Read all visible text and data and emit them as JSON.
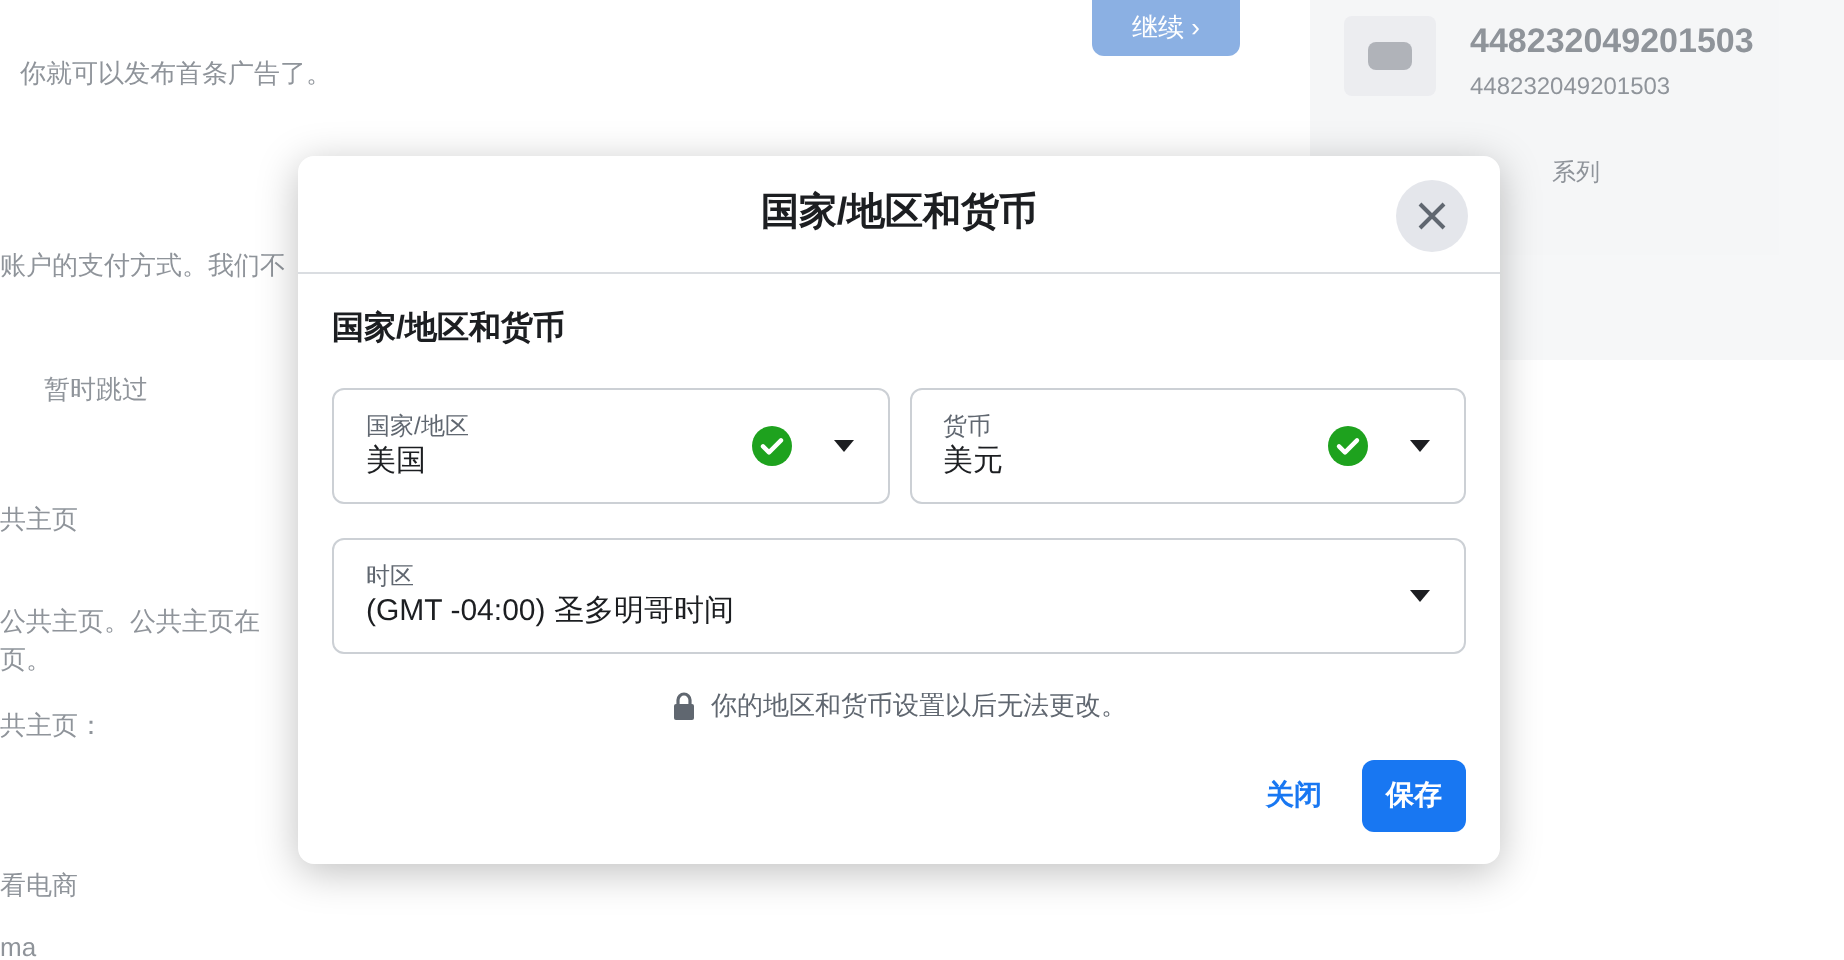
{
  "background": {
    "top_button": "继续",
    "top_button_chevron": "›",
    "intro": "你就可以发布首条广告了。",
    "payment_text": "账户的支付方式。我们不",
    "skip_link": "暂时跳过",
    "page_heading": "共主页",
    "page_text": [
      "公共主页。公共主页在",
      "页。"
    ],
    "page_label": "共主页：",
    "item_1": "看电商",
    "item_2": "ma",
    "account": {
      "name": "448232049201503",
      "id": "448232049201503",
      "caption": "系列"
    }
  },
  "dialog": {
    "title": "国家/地区和货币",
    "section_title": "国家/地区和货币",
    "fields": [
      {
        "label": "国家/地区",
        "value": "美国",
        "valid": true
      },
      {
        "label": "货币",
        "value": "美元",
        "valid": true
      },
      {
        "label": "时区",
        "value": "(GMT -04:00) 圣多明哥时间",
        "valid": false
      }
    ],
    "note": "你的地区和货币设置以后无法更改。",
    "buttons": [
      {
        "label": "关闭",
        "kind": "text"
      },
      {
        "label": "保存",
        "kind": "primary"
      }
    ]
  }
}
